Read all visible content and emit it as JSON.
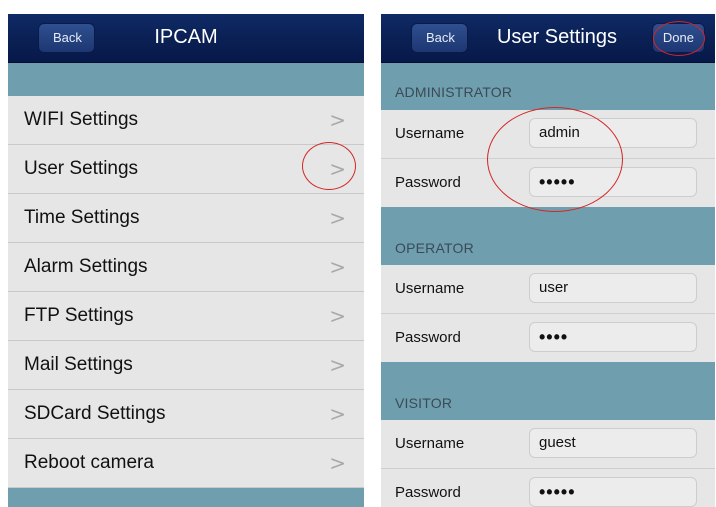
{
  "left": {
    "back_label": "Back",
    "title": "IPCAM",
    "menu": [
      {
        "label": "WIFI Settings"
      },
      {
        "label": "User Settings"
      },
      {
        "label": "Time Settings"
      },
      {
        "label": "Alarm Settings"
      },
      {
        "label": "FTP Settings"
      },
      {
        "label": "Mail Settings"
      },
      {
        "label": "SDCard Settings"
      },
      {
        "label": "Reboot camera"
      }
    ],
    "chevron": ">"
  },
  "right": {
    "back_label": "Back",
    "title": "User Settings",
    "done_label": "Done",
    "sections": [
      {
        "header": "ADMINISTRATOR",
        "username_label": "Username",
        "username": "admin",
        "password_label": "Password",
        "password": "•••••"
      },
      {
        "header": "OPERATOR",
        "username_label": "Username",
        "username": "user",
        "password_label": "Password",
        "password": "••••"
      },
      {
        "header": "VISITOR",
        "username_label": "Username",
        "username": "guest",
        "password_label": "Password",
        "password": "•••••"
      }
    ]
  },
  "colors": {
    "navbar": "#0a1f52",
    "background": "#6f9fae",
    "row": "#e6e6e6",
    "annotation_circle": "#d32626"
  }
}
